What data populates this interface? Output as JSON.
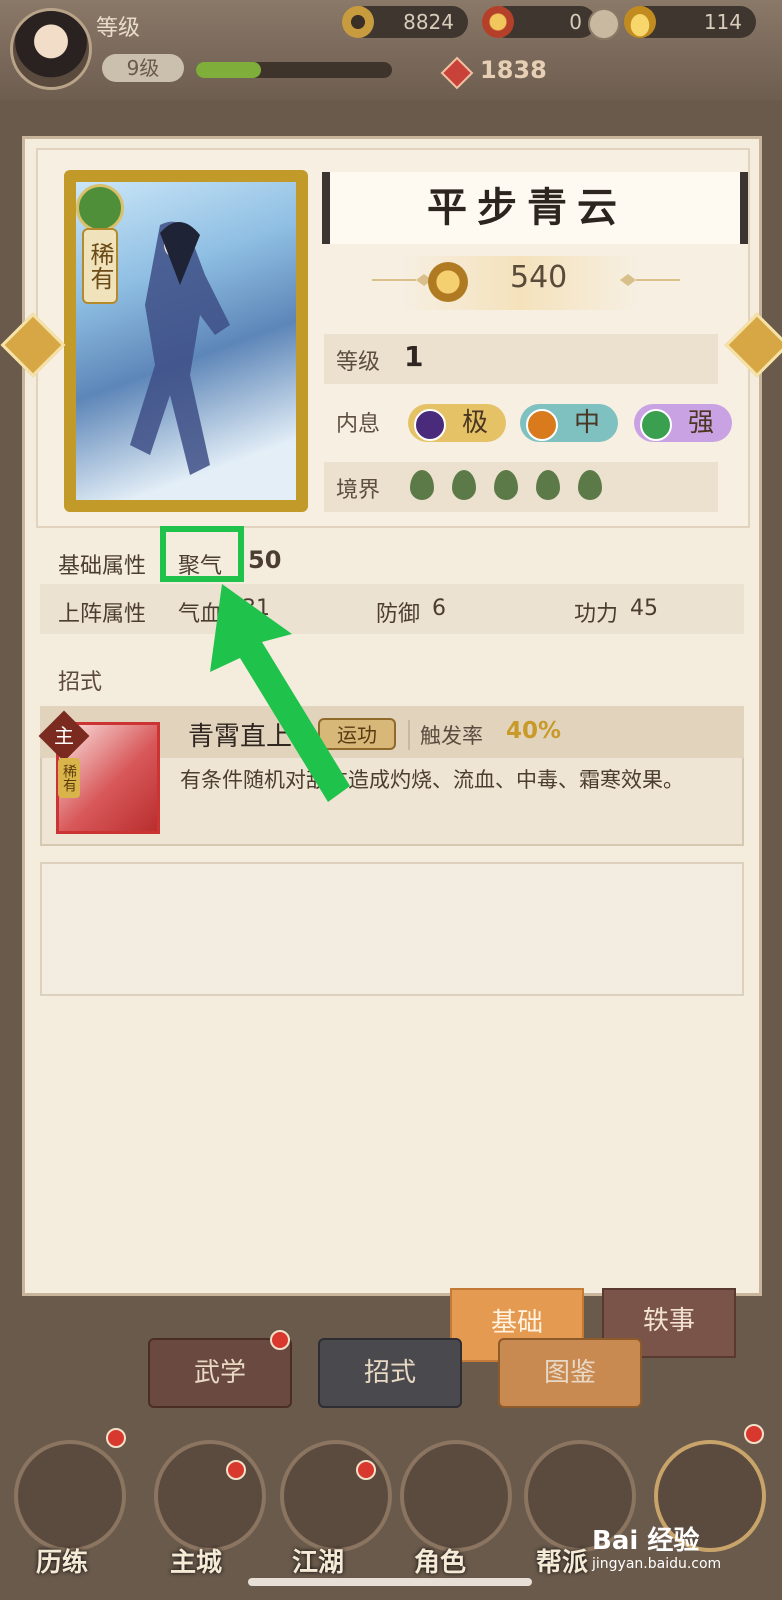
{
  "header": {
    "level_title": "等级",
    "level_pill": "9级",
    "xp_progress": 0.33,
    "currencies": [
      {
        "icon": "copper-coin-icon",
        "value": "8824"
      },
      {
        "icon": "token-icon",
        "value": "0"
      },
      {
        "icon": "gold-ingot-icon",
        "value": "114"
      }
    ],
    "power_icon": "combat-power-icon",
    "power_value": "1838"
  },
  "card": {
    "rarity_label": "稀有",
    "element_icon": "wind-element-icon",
    "name": "平步青云",
    "score": "540"
  },
  "stats": {
    "level_label": "等级",
    "level_value": "1",
    "inner_label": "内息",
    "inner": [
      {
        "label": "极",
        "dot_color": "#4a2a7a",
        "bg": "#e6c267"
      },
      {
        "label": "中",
        "dot_color": "#d97a1c",
        "bg": "#7fc0c0"
      },
      {
        "label": "强",
        "dot_color": "#3aa050",
        "bg": "#c8a2e3"
      }
    ],
    "realm_label": "境界",
    "realm_count": 5
  },
  "attributes": {
    "base_label": "基础属性",
    "base_name": "聚气",
    "base_value": "50",
    "deploy_label": "上阵属性",
    "deploy": [
      {
        "name": "气血",
        "value": "331"
      },
      {
        "name": "防御",
        "value": "6"
      },
      {
        "name": "功力",
        "value": "45"
      }
    ]
  },
  "skills": {
    "title": "招式",
    "item": {
      "main_badge": "主",
      "rare_badge": "稀有",
      "name": "青霄直上",
      "type": "运功",
      "trigger_label": "触发率",
      "trigger_value": "40%",
      "description": "有条件随机对敌方造成灼烧、流血、中毒、霜寒效果。"
    }
  },
  "tabs": {
    "basic": "基础",
    "story": "轶事",
    "martial": "武学",
    "moves": "招式",
    "codex": "图鉴"
  },
  "nav": [
    {
      "label": "历练",
      "icon": "training-icon"
    },
    {
      "label": "主城",
      "icon": "main-city-icon"
    },
    {
      "label": "江湖",
      "icon": "jianghu-icon"
    },
    {
      "label": "角色",
      "icon": "character-icon"
    },
    {
      "label": "帮派",
      "icon": "guild-icon"
    }
  ],
  "watermark": {
    "text": "Bai 经验",
    "sub": "jingyan.baidu.com"
  },
  "colors": {
    "highlight": "#1fc24a",
    "accent_gold": "#c89a2a"
  }
}
